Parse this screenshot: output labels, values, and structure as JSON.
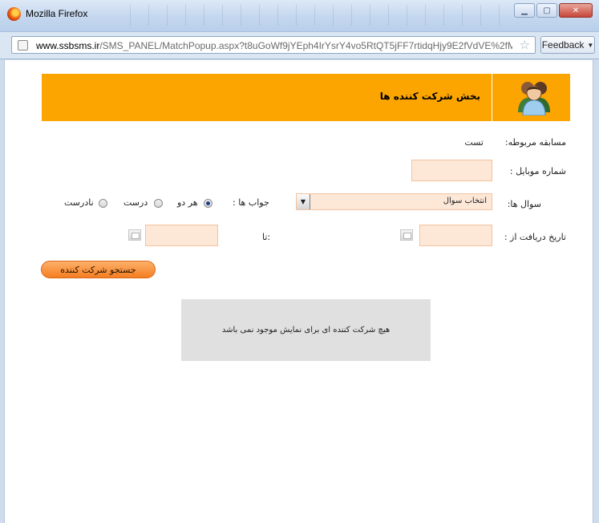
{
  "window": {
    "title": "Mozilla Firefox",
    "url_host": "www.ssbsms.ir",
    "url_path": "/SMS_PANEL/MatchPopup.aspx?t8uGoWf9jYEph4IrYsrY4vo5RtQT5jFF7rtidqHjy9E2fVdVE%2fMjgIigGa",
    "feedback_label": "Feedback"
  },
  "header": {
    "title": "بخش شرکت کننده ها"
  },
  "form": {
    "competition_label": "مسابقه مربوطه:",
    "competition_value": "تست",
    "mobile_label": "شماره موبایل :",
    "mobile_value": "",
    "questions_label": "سوال ها:",
    "questions_selected": "انتخاب سوال",
    "answers_label": "جواب ها :",
    "answer_options": [
      "هر دو",
      "درست",
      "نادرست"
    ],
    "date_from_label": "تاریخ دریافت از :",
    "date_to_label": ":تا",
    "date_from_value": "",
    "date_to_value": "",
    "search_label": "جستجو شرکت کننده"
  },
  "results": {
    "empty_message": "هیچ شرکت کننده ای برای نمایش موجود نمی باشد"
  }
}
